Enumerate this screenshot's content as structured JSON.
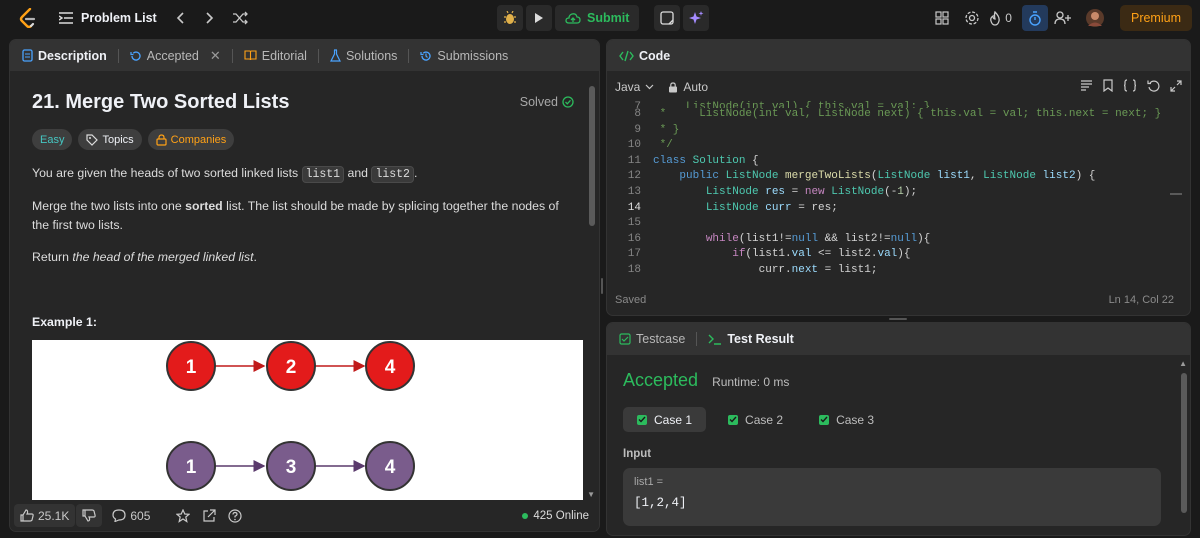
{
  "topbar": {
    "problem_list": "Problem List",
    "submit_label": "Submit",
    "streak_count": "0",
    "premium_label": "Premium"
  },
  "desc_tabs": [
    {
      "label": "Description"
    },
    {
      "label": "Accepted"
    },
    {
      "label": "Editorial"
    },
    {
      "label": "Solutions"
    },
    {
      "label": "Submissions"
    }
  ],
  "problem": {
    "title": "21. Merge Two Sorted Lists",
    "status": "Solved",
    "tags": [
      "Easy",
      "Topics",
      "Companies"
    ],
    "p1_a": "You are given the heads of two sorted linked lists ",
    "p1_code1": "list1",
    "p1_b": " and ",
    "p1_code2": "list2",
    "p1_c": ".",
    "p2_a": "Merge the two lists into one ",
    "p2_bold": "sorted",
    "p2_b": " list. The list should be made by splicing together the nodes of the first two lists.",
    "p3_a": "Return ",
    "p3_em": "the head of the merged linked list",
    "p3_b": ".",
    "example_title": "Example 1:",
    "list1_nodes": [
      "1",
      "2",
      "4"
    ],
    "list2_nodes": [
      "1",
      "3",
      "4"
    ]
  },
  "footer": {
    "likes": "25.1K",
    "comments": "605",
    "online": "425 Online"
  },
  "code_panel": {
    "title": "Code",
    "language": "Java",
    "mode": "Auto",
    "saved": "Saved",
    "cursor": "Ln 14, Col 22"
  },
  "result_panel": {
    "tab_testcase": "Testcase",
    "tab_result": "Test Result",
    "verdict": "Accepted",
    "runtime": "Runtime: 0 ms",
    "cases": [
      "Case 1",
      "Case 2",
      "Case 3"
    ],
    "input_label": "Input",
    "input_name": "list1 =",
    "input_value": "[1,2,4]"
  },
  "colors": {
    "accent": "#ffa116",
    "success": "#2cbb5d",
    "node_red": "#e31b1b",
    "node_purple": "#7a5c8c"
  }
}
